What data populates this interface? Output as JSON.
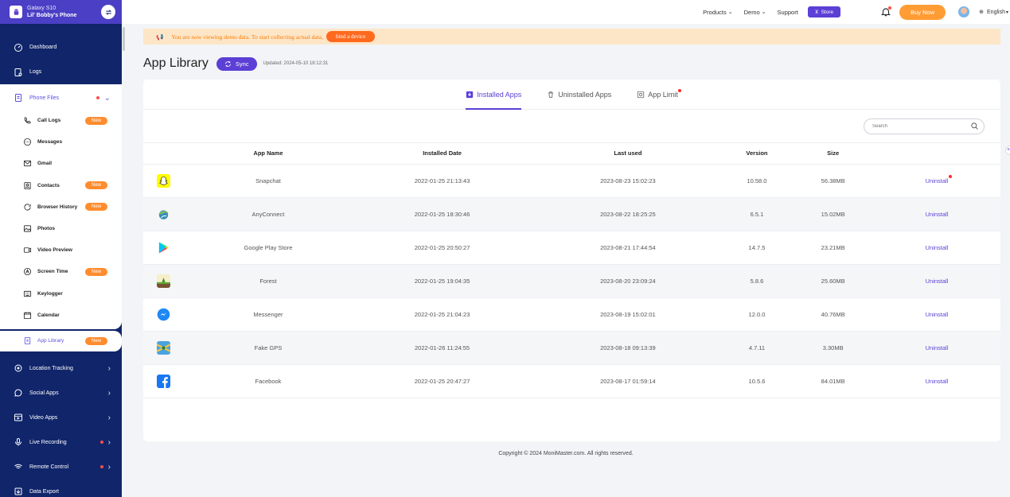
{
  "device": {
    "model": "Galaxy S10",
    "owner": "Lil' Bobby's Phone"
  },
  "sidebar": {
    "top_items": [
      {
        "label": "Dashboard"
      },
      {
        "label": "Logs"
      }
    ],
    "phone_files": {
      "label": "Phone Files",
      "items": [
        {
          "label": "Call Logs",
          "badge": "New"
        },
        {
          "label": "Messages",
          "badge": ""
        },
        {
          "label": "Gmail",
          "badge": ""
        },
        {
          "label": "Contacts",
          "badge": "New"
        },
        {
          "label": "Browser History",
          "badge": "New"
        },
        {
          "label": "Photos",
          "badge": ""
        },
        {
          "label": "Video Preview",
          "badge": ""
        },
        {
          "label": "Screen Time",
          "badge": "New"
        },
        {
          "label": "Keylogger",
          "badge": ""
        },
        {
          "label": "Calendar",
          "badge": ""
        }
      ],
      "active_item": {
        "label": "App Library",
        "badge": "New"
      }
    },
    "bottom_items": [
      {
        "label": "Location Tracking"
      },
      {
        "label": "Social Apps"
      },
      {
        "label": "Video Apps"
      },
      {
        "label": "Live Recording"
      },
      {
        "label": "Remote Control"
      },
      {
        "label": "Data Export"
      }
    ]
  },
  "topbar": {
    "products": "Products",
    "demo": "Demo",
    "support": "Support",
    "store": "Store",
    "buy_now": "Buy Now",
    "language": "English"
  },
  "banner": {
    "text": "You are now viewing demo data. To start collecting actual data,",
    "button": "bind a device"
  },
  "page": {
    "title": "App Library",
    "sync_label": "Sync",
    "updated": "Updated: 2024-05-10 18:12:31"
  },
  "tabs": [
    {
      "label": "Installed Apps"
    },
    {
      "label": "Uninstalled Apps"
    },
    {
      "label": "App Limit"
    }
  ],
  "search": {
    "placeholder": "Search"
  },
  "table": {
    "headers": [
      "App Name",
      "Installed Date",
      "Last used",
      "Version",
      "Size"
    ],
    "action_label": "Uninstall",
    "rows": [
      {
        "name": "Snapchat",
        "installed": "2022-01-25 21:13:43",
        "last_used": "2023-08-23 15:02:23",
        "version": "10.58.0",
        "size": "56.38MB",
        "action": "Uninstall"
      },
      {
        "name": "AnyConnect",
        "installed": "2022-01-25 18:30:46",
        "last_used": "2023-08-22 18:25:25",
        "version": "6.5.1",
        "size": "15.02MB",
        "action": "Uninstall"
      },
      {
        "name": "Google Play Store",
        "installed": "2022-01-25 20:50:27",
        "last_used": "2023-08-21 17:44:54",
        "version": "14.7.5",
        "size": "23.21MB",
        "action": "Uninstall"
      },
      {
        "name": "Forest",
        "installed": "2022-01-25 19:04:35",
        "last_used": "2023-08-20 23:09:24",
        "version": "5.8.6",
        "size": "25.60MB",
        "action": "Uninstall"
      },
      {
        "name": "Messenger",
        "installed": "2022-01-25 21:04:23",
        "last_used": "2023-08-19 15:02:01",
        "version": "12.0.0",
        "size": "40.76MB",
        "action": "Uninstall"
      },
      {
        "name": "Fake GPS",
        "installed": "2022-01-26 11:24:55",
        "last_used": "2023-08-18 09:13:39",
        "version": "4.7.11",
        "size": "3.30MB",
        "action": "Uninstall"
      },
      {
        "name": "Facebook",
        "installed": "2022-01-25 20:47:27",
        "last_used": "2023-08-17 01:59:14",
        "version": "10.5.6",
        "size": "84.01MB",
        "action": "Uninstall"
      }
    ]
  },
  "footer": {
    "copyright": "Copyright © 2024 MoniMaster.com. All rights reserved."
  },
  "colors": {
    "primary": "#5b3fd6",
    "sidebar": "#10256a",
    "orange": "#ff8c2e",
    "banner_bg": "#fde6c7"
  }
}
